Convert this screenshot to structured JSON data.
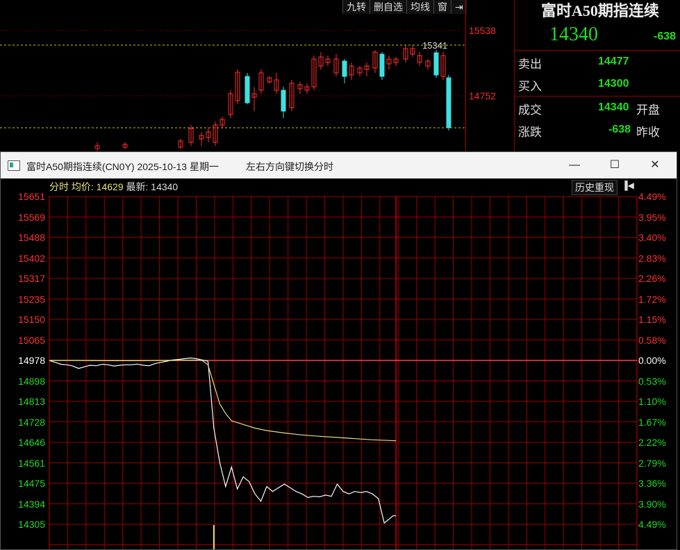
{
  "toolbar": {
    "items": [
      "九转",
      "删自选",
      "均线",
      "窗"
    ]
  },
  "kline_axis": {
    "labels": [
      "15538",
      "14752"
    ],
    "high_marker": "15341"
  },
  "quote": {
    "title": "富时A50期指连续",
    "price": "14340",
    "change": "-638",
    "rows": [
      {
        "label": "卖出",
        "value": "14477",
        "extra": ""
      },
      {
        "label": "买入",
        "value": "14300",
        "extra": ""
      },
      {
        "label": "成交",
        "value": "14340",
        "extra": "开盘"
      },
      {
        "label": "涨跌",
        "value": "-638",
        "extra": "昨收"
      }
    ]
  },
  "window": {
    "title": "富时A50期指连续(CN0Y) 2025-10-13 星期一",
    "hint": "左右方向键切换分时",
    "minimize_icon": "minimize-icon",
    "maximize_icon": "maximize-icon",
    "close_icon": "close-icon"
  },
  "chart_header": {
    "mode": "分时",
    "avg_label": "均价:",
    "avg_value": "14629",
    "latest_label": "最新:",
    "latest_value": "14340",
    "history_button": "历史重现"
  },
  "colors": {
    "up": "#ff3333",
    "down": "#22dd22",
    "grid": "#9a0000",
    "price_line": "#ffffff",
    "avg_line": "#e6e080"
  },
  "chart_data": {
    "type": "line",
    "title": "",
    "prev_close": 14978,
    "ylim": [
      14305,
      15651
    ],
    "y_ticks_left": [
      "15651",
      "15569",
      "15488",
      "15402",
      "15317",
      "15235",
      "15150",
      "15065",
      "14978",
      "14898",
      "14813",
      "14728",
      "14646",
      "14561",
      "14475",
      "14394",
      "14305"
    ],
    "y_ticks_right": [
      "4.49%",
      "3.95%",
      "3.40%",
      "2.83%",
      "2.26%",
      "1.72%",
      "1.15%",
      "0.58%",
      "0.00%",
      "0.53%",
      "1.10%",
      "1.67%",
      "2.22%",
      "2.79%",
      "3.36%",
      "3.90%",
      "4.49%"
    ],
    "x_range": [
      0,
      100
    ],
    "x_current": 59,
    "series": [
      {
        "name": "最新",
        "x": [
          0,
          1,
          2,
          3,
          4,
          5,
          6,
          7,
          8,
          9,
          10,
          11,
          12,
          13,
          14,
          15,
          16,
          17,
          18,
          19,
          20,
          21,
          22,
          23,
          24,
          25,
          26,
          27,
          28,
          29,
          30,
          31,
          32,
          33,
          34,
          35,
          36,
          37,
          38,
          39,
          40,
          41,
          42,
          43,
          44,
          45,
          46,
          47,
          48,
          49,
          50,
          51,
          52,
          53,
          54,
          55,
          56,
          57,
          58,
          58.5,
          59
        ],
        "values": [
          14978,
          14970,
          14962,
          14960,
          14955,
          14945,
          14952,
          14958,
          14956,
          14962,
          14960,
          14955,
          14958,
          14960,
          14960,
          14963,
          14958,
          14956,
          14965,
          14970,
          14975,
          14980,
          14982,
          14985,
          14988,
          14985,
          14980,
          14975,
          14700,
          14560,
          14460,
          14540,
          14450,
          14500,
          14480,
          14430,
          14400,
          14460,
          14440,
          14455,
          14470,
          14455,
          14440,
          14430,
          14415,
          14420,
          14418,
          14425,
          14420,
          14470,
          14440,
          14430,
          14440,
          14435,
          14440,
          14430,
          14410,
          14310,
          14330,
          14340,
          14340
        ]
      },
      {
        "name": "均价",
        "x": [
          0,
          5,
          10,
          15,
          20,
          25,
          26,
          27,
          28,
          29,
          30,
          31,
          33,
          35,
          37,
          40,
          43,
          45,
          50,
          55,
          59
        ],
        "values": [
          14978,
          14978,
          14977,
          14977,
          14978,
          14979,
          14978,
          14960,
          14880,
          14800,
          14760,
          14730,
          14715,
          14700,
          14690,
          14680,
          14672,
          14668,
          14660,
          14652,
          14648
        ]
      }
    ],
    "volume": [
      {
        "x": 28,
        "value": 35
      }
    ]
  }
}
